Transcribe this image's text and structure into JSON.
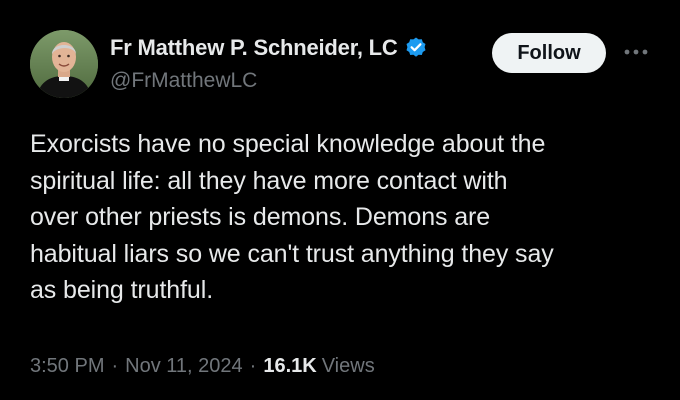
{
  "author": {
    "display_name": "Fr Matthew P. Schneider, LC",
    "handle": "@FrMatthewLC",
    "verified": true,
    "avatar_icon": "avatar-photo"
  },
  "actions": {
    "follow_label": "Follow",
    "more_icon": "more-horizontal-icon"
  },
  "tweet": {
    "text": "Exorcists have no special knowledge about the\nspiritual life: all they have more contact with\nover other priests is demons. Demons are\nhabitual liars so we can't trust anything they say\nas being truthful."
  },
  "meta": {
    "time": "3:50 PM",
    "separator": "·",
    "date": "Nov 11, 2024",
    "views_count": "16.1K",
    "views_label": "Views"
  },
  "colors": {
    "background": "#000000",
    "primary_text": "#e7e9ea",
    "secondary_text": "#71767b",
    "verified_blue": "#1d9bf0",
    "follow_button_bg": "#eff3f4"
  }
}
